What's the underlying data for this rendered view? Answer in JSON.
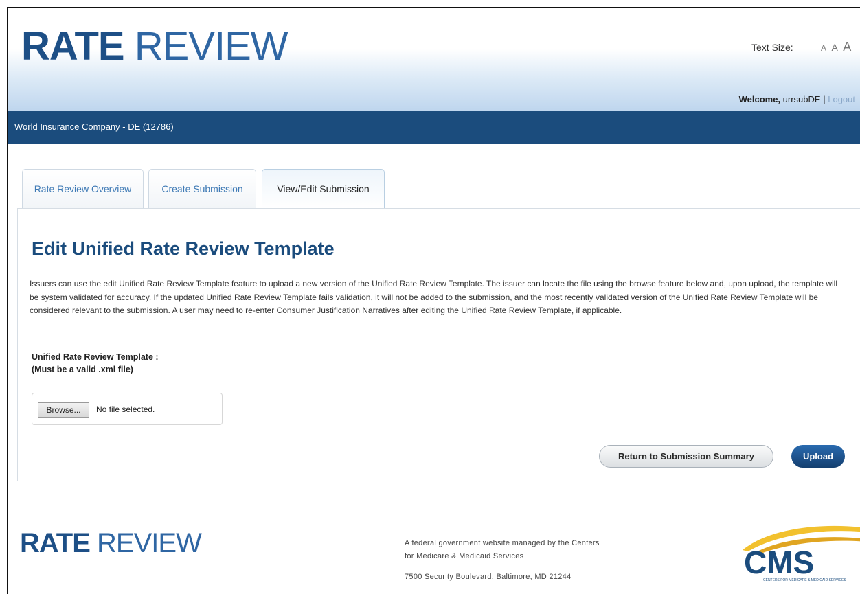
{
  "header": {
    "logo_bold": "RATE",
    "logo_light": "REVIEW",
    "text_size_label": "Text Size:",
    "text_size_options": [
      "A",
      "A",
      "A"
    ],
    "welcome_label": "Welcome,",
    "username": "urrsubDE",
    "separator": "|",
    "logout": "Logout"
  },
  "org": {
    "name": "World Insurance Company - DE (12786)"
  },
  "tabs": [
    {
      "label": "Rate Review Overview"
    },
    {
      "label": "Create Submission"
    },
    {
      "label": "View/Edit Submission"
    }
  ],
  "main": {
    "title": "Edit Unified Rate Review Template",
    "description": "Issuers can use the edit Unified Rate Review Template feature to upload a new version of the Unified Rate Review Template. The issuer can locate the file using the browse feature below and, upon upload, the template will be system validated for accuracy. If the updated Unified Rate Review Template fails validation, it will not be added to the submission, and the most recently validated version of the Unified Rate Review Template will be considered relevant to the submission. A user may need to re-enter Consumer Justification Narratives after editing the Unified Rate Review Template, if applicable.",
    "field_label": "Unified Rate Review Template :",
    "field_hint": "(Must be a valid .xml file)",
    "browse_label": "Browse...",
    "file_status": "No file selected.",
    "return_button": "Return to Submission Summary",
    "upload_button": "Upload"
  },
  "footer": {
    "logo_bold": "RATE",
    "logo_light": "REVIEW",
    "fed_line1": "A federal government website managed by the Centers",
    "fed_line2": "for Medicare & Medicaid Services",
    "address": "7500 Security Boulevard, Baltimore, MD 21244",
    "cms_logo": "CMS",
    "cms_subtext": "CENTERS FOR MEDICARE & MEDICAID SERVICES"
  },
  "colors": {
    "brand_navy": "#1b4c7d",
    "logo_blue": "#1d4f86",
    "cms_gold": "#f2c12e"
  }
}
